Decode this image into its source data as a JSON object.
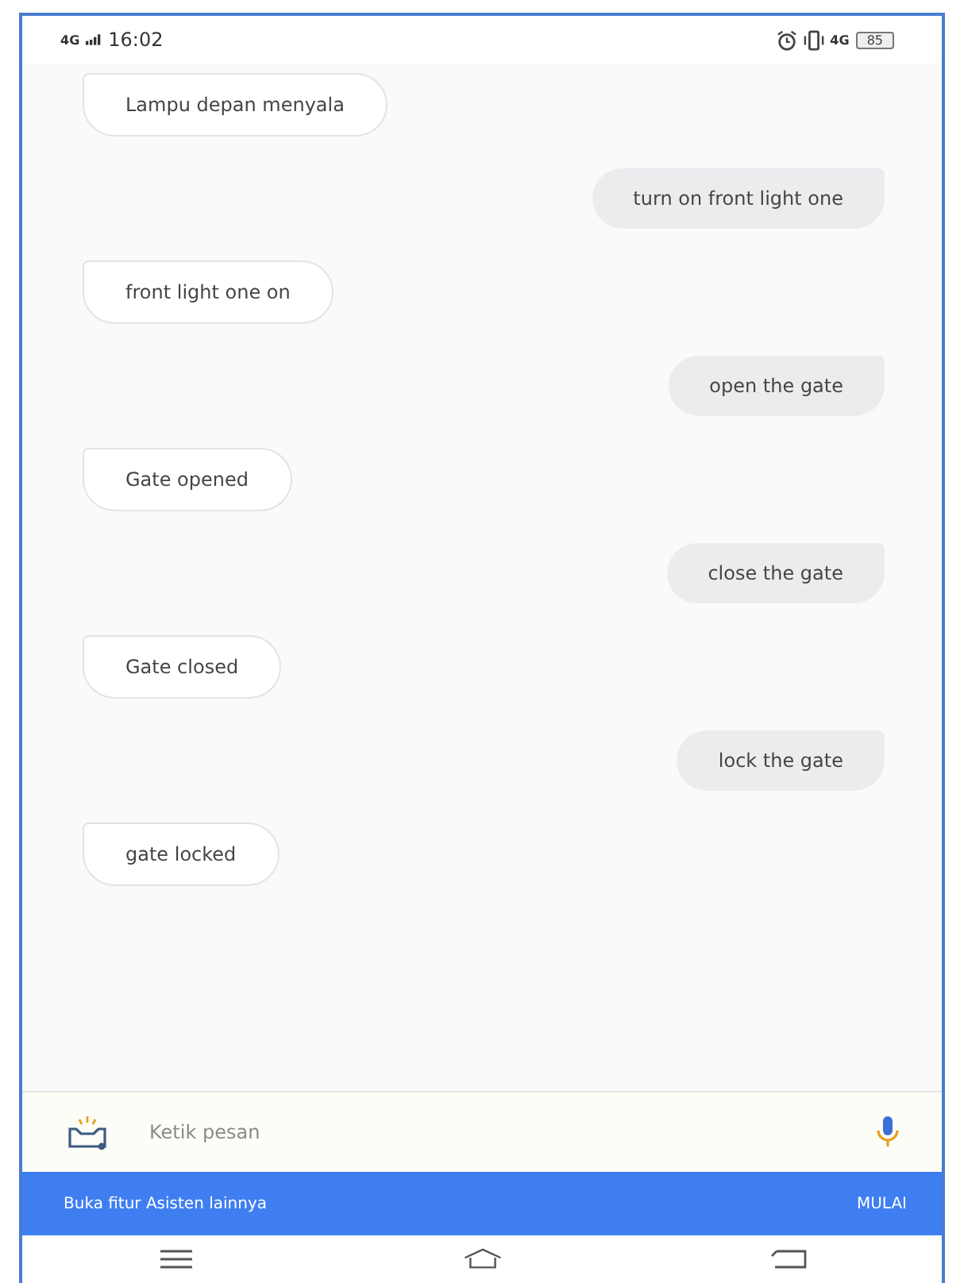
{
  "status_bar": {
    "network": "4G",
    "time": "16:02",
    "network_right": "4G",
    "battery": "85"
  },
  "messages": [
    {
      "kind": "bot",
      "text": "Lampu depan menyala"
    },
    {
      "kind": "user",
      "text": "turn on front light one"
    },
    {
      "kind": "bot",
      "text": "front light one on"
    },
    {
      "kind": "user",
      "text": "open the gate"
    },
    {
      "kind": "bot",
      "text": "Gate opened"
    },
    {
      "kind": "user",
      "text": "close the gate"
    },
    {
      "kind": "bot",
      "text": "Gate closed"
    },
    {
      "kind": "user",
      "text": "lock the gate"
    },
    {
      "kind": "bot",
      "text": "gate locked"
    }
  ],
  "input": {
    "placeholder": "Ketik pesan"
  },
  "banner": {
    "text": "Buka fitur Asisten lainnya",
    "action": "MULAI"
  }
}
